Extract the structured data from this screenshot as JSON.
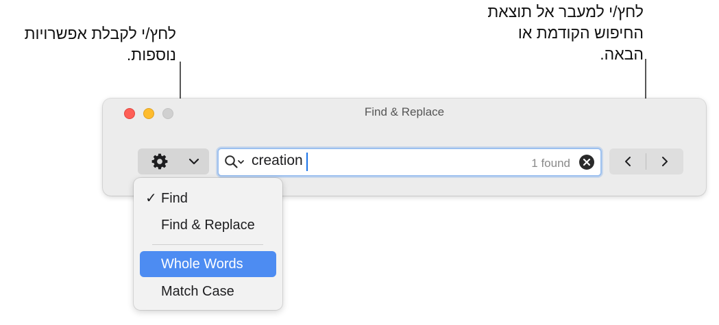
{
  "callouts": {
    "options": "לחץ/י לקבלת אפשרויות\nנוספות.",
    "navigate": "לחץ/י למעבר אל תוצאת\nהחיפוש הקודמת או\nהבאה."
  },
  "window": {
    "title": "Find & Replace"
  },
  "toolbar": {
    "options_icon": "gear-icon",
    "options_chevron_icon": "chevron-down-icon"
  },
  "search": {
    "icon": "magnifier-with-dropdown-icon",
    "query": "creation",
    "result_count": "1 found",
    "clear_icon": "clear-circle-icon"
  },
  "navigation": {
    "previous_icon": "chevron-left-icon",
    "next_icon": "chevron-right-icon"
  },
  "options_menu": {
    "items": [
      {
        "label": "Find",
        "checked": "✓"
      },
      {
        "label": "Find & Replace"
      },
      {
        "label": "Whole Words",
        "highlighted": true
      },
      {
        "label": "Match Case"
      }
    ]
  },
  "colors": {
    "highlight": "#4d8cf2",
    "search_focus_ring": "#9cc0ef",
    "close_button": "#fe5f57",
    "minimize_button": "#febc2e"
  }
}
